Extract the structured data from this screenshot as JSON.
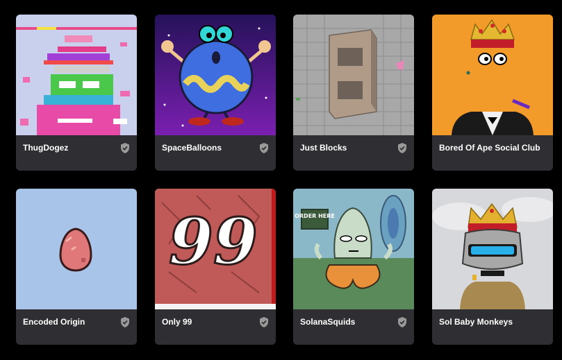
{
  "collections": [
    {
      "name": "ThugDogez",
      "verified": true,
      "image": "thugdogez-artwork"
    },
    {
      "name": "SpaceBalloons",
      "verified": true,
      "image": "spaceballoons-artwork"
    },
    {
      "name": "Just Blocks",
      "verified": true,
      "image": "just-blocks-artwork"
    },
    {
      "name": "Bored Of Ape Social Club",
      "verified": false,
      "image": "bored-of-ape-artwork"
    },
    {
      "name": "Encoded Origin",
      "verified": true,
      "image": "encoded-origin-artwork"
    },
    {
      "name": "Only 99",
      "verified": true,
      "image": "only-99-artwork"
    },
    {
      "name": "SolanaSquids",
      "verified": true,
      "image": "solanasquids-artwork"
    },
    {
      "name": "Sol Baby Monkeys",
      "verified": false,
      "image": "sol-baby-monkeys-artwork"
    }
  ],
  "artwork_text": {
    "only99": "99",
    "order_here": "ORDER HERE"
  },
  "colors": {
    "page_bg": "#000000",
    "card_bg": "#2f2f33",
    "badge": "#9a9a9a"
  },
  "icons": {
    "verified": "shield-check-icon"
  }
}
